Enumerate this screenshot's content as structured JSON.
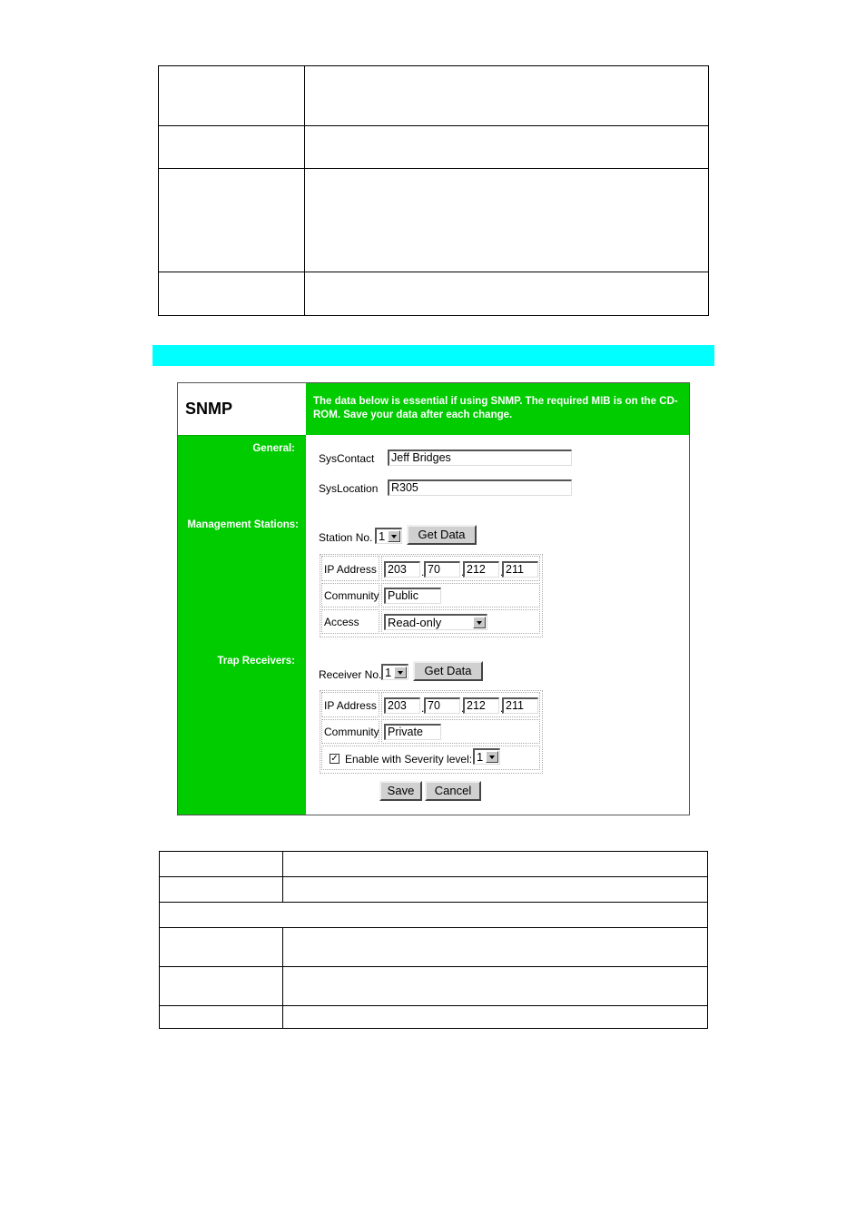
{
  "colors": {
    "accent_green": "#00cc00",
    "heading_bar": "#00ffff",
    "header_text": "#ffffff"
  },
  "panel": {
    "title": "SNMP",
    "description": "The data below is essential if using SNMP. The required MIB is on the CD-ROM. Save your data after each change.",
    "sections": {
      "general": "General:",
      "management_stations": "Management Stations:",
      "trap_receivers": "Trap Receivers:"
    },
    "general": {
      "syscontact_label": "SysContact",
      "syscontact_value": "Jeff Bridges",
      "syslocation_label": "SysLocation",
      "syslocation_value": "R305"
    },
    "management": {
      "station_no_label": "Station No.",
      "station_no_value": "1",
      "get_data_label": "Get Data",
      "ip_label": "IP Address",
      "ip": [
        "203",
        "70",
        "212",
        "211"
      ],
      "community_label": "Community",
      "community_value": "Public",
      "access_label": "Access",
      "access_value": "Read-only"
    },
    "trap": {
      "receiver_no_label": "Receiver No.",
      "receiver_no_value": "1",
      "get_data_label": "Get Data",
      "ip_label": "IP Address",
      "ip": [
        "203",
        "70",
        "212",
        "211"
      ],
      "community_label": "Community",
      "community_value": "Private",
      "enable_label": "Enable with Severity level:",
      "enable_checked": true,
      "severity_value": "1"
    },
    "buttons": {
      "save": "Save",
      "cancel": "Cancel"
    }
  }
}
